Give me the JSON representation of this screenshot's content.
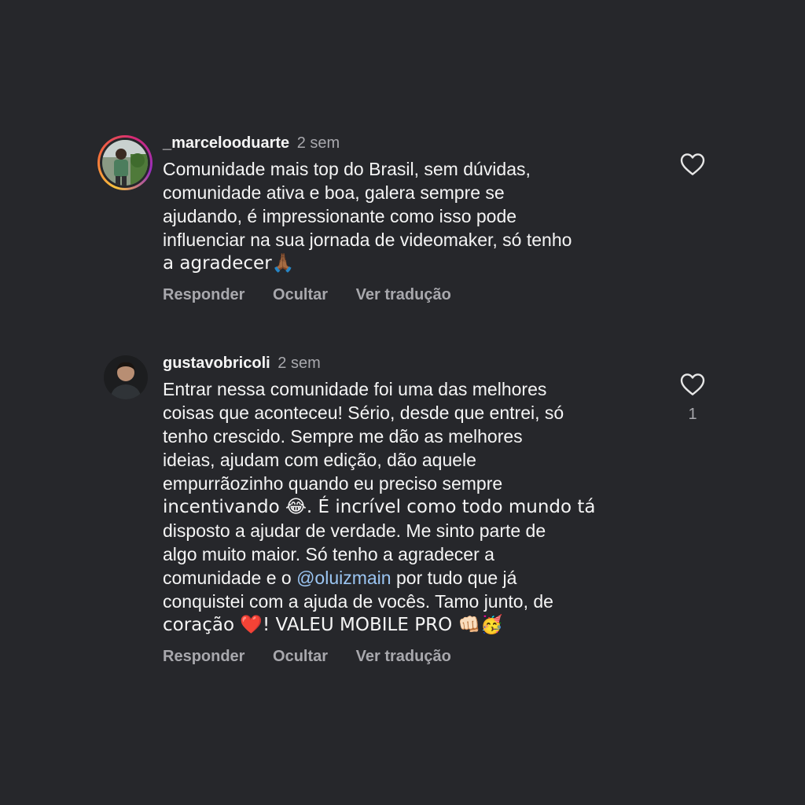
{
  "comments": [
    {
      "username": "_marcelooduarte",
      "time": "2 sem",
      "avatar_story_ring": true,
      "lines": [
        "Comunidade mais top do Brasil, sem dúvidas,",
        "comunidade ativa e boa, galera sempre se",
        "ajudando, é impressionante como isso pode",
        "influenciar na sua jornada de videomaker, só tenho",
        "a agradecer🙏🏾"
      ],
      "actions": {
        "reply": "Responder",
        "hide": "Ocultar",
        "translate": "Ver tradução"
      },
      "like_icon": "heart-outline-icon",
      "like_count": ""
    },
    {
      "username": "gustavobricoli",
      "time": "2 sem",
      "avatar_story_ring": false,
      "lines": [
        "Entrar nessa comunidade foi uma das melhores",
        "coisas que aconteceu! Sério, desde que entrei, só",
        "tenho crescido. Sempre me dão as melhores",
        "ideias, ajudam com edição, dão aquele",
        "empurrãozinho quando eu preciso sempre",
        "incentivando 😂. É incrível como todo mundo tá",
        "disposto a ajudar de verdade. Me sinto parte de",
        "algo muito maior. Só tenho a agradecer a",
        "comunidade e o ",
        "@oluizmain",
        " por tudo que já",
        "conquistei com a ajuda de vocês. Tamo junto, de",
        "coração ❤️! VALEU MOBILE PRO 👊🏻🥳"
      ],
      "actions": {
        "reply": "Responder",
        "hide": "Ocultar",
        "translate": "Ver tradução"
      },
      "like_icon": "heart-outline-icon",
      "like_count": "1"
    }
  ],
  "colors": {
    "background": "#26272b",
    "primary_text": "#f5f5f5",
    "secondary_text": "#a8a8ad",
    "mention": "#9bc5f2"
  }
}
